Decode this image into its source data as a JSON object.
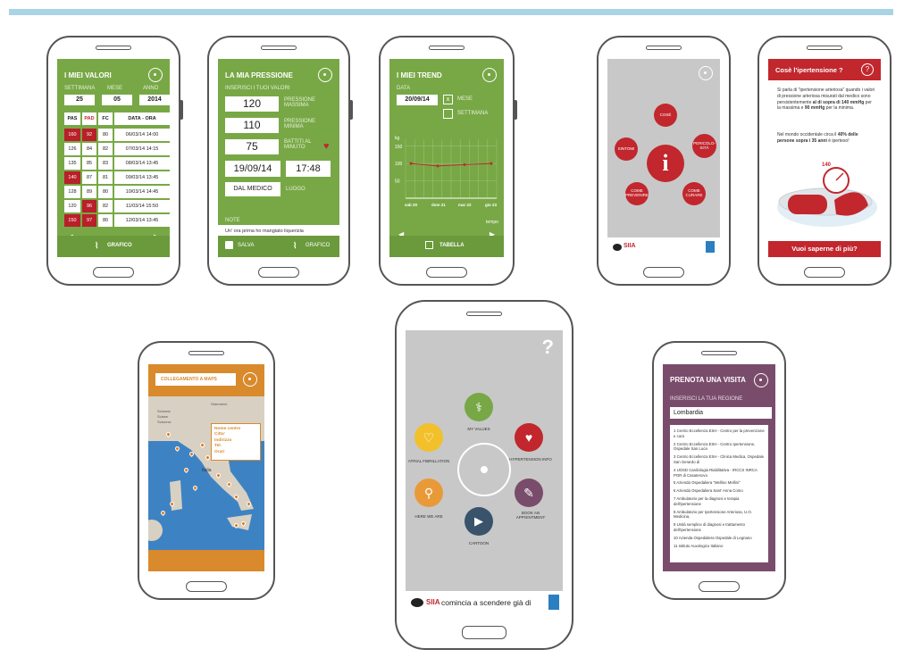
{
  "s1": {
    "title": "I MIEI VALORI",
    "col_labels": [
      "SETTIMANA",
      "MESE",
      "ANNO"
    ],
    "col_values": [
      "25",
      "05",
      "2014"
    ],
    "headers": [
      "PAS",
      "PAD",
      "FC",
      "DATA - ORA"
    ],
    "rows": [
      [
        "160",
        "92",
        "80",
        "06/03/14 14:00"
      ],
      [
        "126",
        "84",
        "82",
        "07/03/14 14:15"
      ],
      [
        "135",
        "85",
        "83",
        "08/03/14 13:45"
      ],
      [
        "140",
        "87",
        "81",
        "09/03/14 13:45"
      ],
      [
        "128",
        "89",
        "80",
        "10/03/14 14:45"
      ],
      [
        "120",
        "96",
        "82",
        "11/03/14 15:50"
      ],
      [
        "150",
        "97",
        "80",
        "12/03/14 13:45"
      ]
    ],
    "footer": "GRAFICO"
  },
  "s2": {
    "title": "LA MIA PRESSIONE",
    "subtitle": "INSERISCI I TUOI VALORI",
    "v1": "120",
    "l1": "PRESSIONE MASSIMA",
    "v2": "110",
    "l2": "PRESSIONE MINIMA",
    "v3": "75",
    "l3": "BATTITI AL MINUTO",
    "date": "19/09/14",
    "time": "17:48",
    "where": "DAL MEDICO",
    "where_lbl": "LUOGO",
    "notes_lbl": "NOTE",
    "note": "Un' ora prima ho mangiato liquerizia",
    "save": "SALVA",
    "chart": "GRAFICO"
  },
  "s3": {
    "title": "I MIEI TREND",
    "data_lbl": "DATA",
    "date": "20/09/14",
    "opt1": "MESE",
    "opt2": "SETTIMANA",
    "yunit": "kg",
    "yticks": [
      "150",
      "100",
      "50"
    ],
    "xticks": [
      "sab 20",
      "dom 21",
      "mar 22",
      "gio 23"
    ],
    "xunit": "tempo",
    "footer": "TABELLA",
    "chart_data": {
      "type": "line",
      "x": [
        "sab 20",
        "dom 21",
        "mar 22",
        "gio 23"
      ],
      "values": [
        100,
        93,
        97,
        100
      ],
      "ylim": [
        0,
        170
      ],
      "ylabel": "kg",
      "xlabel": "tempo"
    }
  },
  "s4": {
    "center": "i",
    "items": [
      "COSÉ",
      "SINTOMI",
      "PERICOLO-SITÀ",
      "COME PREVENIRE",
      "COME CURARE"
    ],
    "logo": "SIIA"
  },
  "s5": {
    "title": "Cosè l'ipertensione ?",
    "p1a": "Si parla di \"ipertensione arteriosa\" quando i valori di pressione arteriosa misurati dal medico sono persistentemente ",
    "p1b": "al di sopra di 140 mmHg",
    "p1c": " per la massima e ",
    "p1d": "90 mmHg",
    "p1e": " per la minima.",
    "p2a": "Nel mondo occidentale circa il ",
    "p2b": "40% delle persone sopra i 35 anni",
    "p2c": " è iperteso!",
    "gauge": "140",
    "footer": "Vuoi saperne di più?"
  },
  "s6": {
    "title": "COLLEGAMENTO A MAPS",
    "pop": [
      "Nome centro",
      "Citta'",
      "Indirizzo",
      "Tel.",
      "Orari"
    ],
    "labels": [
      "Österreich",
      "Schweiz",
      "Suisse",
      "Svizzera",
      "Italia"
    ]
  },
  "s7": {
    "help": "?",
    "items": [
      "MY VALUES",
      "HYPERTENSION INFO",
      "BOOK AN APPOINTMENT",
      "CARTOON",
      "HERE WE ARE",
      "ATRIAL FIBRILLATION"
    ],
    "banner": "comincia a scendere già di",
    "logo": "SIIA"
  },
  "s8": {
    "title": "PRENOTA UNA VISITA",
    "sub": "INSERISCI LA TUA REGIONE",
    "region": "Lombardia",
    "list": [
      "1 Centro Eccellenza ESH - Centro per la prevenzione e cura",
      "2 Centro Eccellenza ESH - Centro Ipertensione, Ospedale San Luca",
      "3 Centro Eccellenza ESH - Clinica Medica, Ospedale San Gerardo di",
      "4 UOSD Cardiologia Riabilitativa - IRCCS INRCA POR di Casatenovo",
      "5 Azienda Ospedaliera \"Mellino Mellini\"",
      "6 Azienda Ospedaliera Sant' Anna Como",
      "7 Ambulatorio per la diagnosi e terapia dell'ipertensione",
      "8 Ambulatorio per Ipertensione Arteriosa, U.O. Medicina,",
      "9 Unità semplice di diagnosi e trattamento dell'ipertensione",
      "10 Azienda Ospedaliera Ospedale di Legnano",
      "11 Istituto Auxologico Italiano"
    ]
  },
  "colors": {
    "green": "#78a846",
    "red": "#c1272d",
    "purple": "#7a4c6c",
    "orange": "#d98a2c",
    "topbar": "#a9d4e6"
  }
}
